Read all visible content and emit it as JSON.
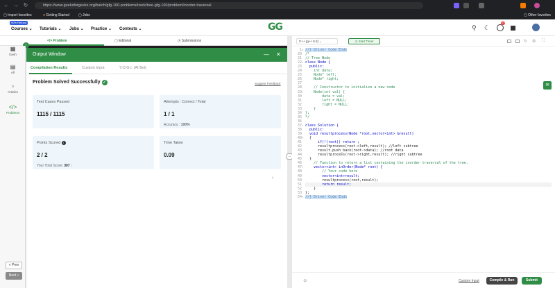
{
  "browser": {
    "url": "https://www.geeksforgeeks.org/batch/gfg-160-problems/track/tree-gfg-160/problem/inorder-traversal",
    "bookmarks": [
      "Import favorites",
      "Getting Started",
      "Jobs"
    ],
    "other_favorites": "Other favorites",
    "notif_count": "27"
  },
  "header": {
    "sale_badge": "90% Refund",
    "menu": [
      "Courses",
      "Tutorials",
      "Jobs",
      "Practice",
      "Contests"
    ],
    "logo_text": "GG"
  },
  "problem_tabs": [
    "Problem",
    "Editorial",
    "Submissions"
  ],
  "rail": {
    "items": [
      "Dash",
      "All",
      "Articles",
      "Problems"
    ],
    "prev": "Prev",
    "next": "Next"
  },
  "output": {
    "title": "Output Window",
    "tabs": [
      "Compilation Results",
      "Custom Input",
      "Y.O.G.I. (AI Bot)"
    ],
    "status": "Problem Solved Successfully",
    "suggest": "Suggest Feedback",
    "cards": {
      "test_label": "Test Cases Passed",
      "test_value": "1115 / 1115",
      "attempts_label": "Attempts : Correct / Total",
      "attempts_value": "1 / 1",
      "accuracy_label": "Accuracy :",
      "accuracy_value": "100%",
      "points_label": "Points Scored",
      "points_value": "2 / 2",
      "total_label": "Your Total Score:",
      "total_value": "307",
      "time_label": "Time Taken",
      "time_value": "0.09"
    }
  },
  "editor": {
    "language": "C++ (g++ 6.2)",
    "timer": "Start Timer",
    "lines": [
      {
        "n": "1",
        "t": "//} Driver Code Ends"
      },
      {
        "n": "20",
        "t": "/*"
      },
      {
        "n": "21",
        "t": "// Tree Node"
      },
      {
        "n": "22",
        "t": "class Node {"
      },
      {
        "n": "23",
        "t": "  public:"
      },
      {
        "n": "24",
        "t": "    int data;"
      },
      {
        "n": "25",
        "t": "    Node* left;"
      },
      {
        "n": "26",
        "t": "    Node* right;"
      },
      {
        "n": "27",
        "t": ""
      },
      {
        "n": "28",
        "t": "    // Constructor to initialize a new node"
      },
      {
        "n": "29",
        "t": "    Node(int val) {"
      },
      {
        "n": "30",
        "t": "        data = val;"
      },
      {
        "n": "31",
        "t": "        left = NULL;"
      },
      {
        "n": "32",
        "t": "        right = NULL;"
      },
      {
        "n": "33",
        "t": "    }"
      },
      {
        "n": "34",
        "t": "};"
      },
      {
        "n": "35",
        "t": "*/"
      },
      {
        "n": "36",
        "t": ""
      },
      {
        "n": "37",
        "t": "class Solution {"
      },
      {
        "n": "38",
        "t": "  public:"
      },
      {
        "n": "39",
        "t": "  void resultprocess(Node *root,vector<int> &result)"
      },
      {
        "n": "40",
        "t": "  {"
      },
      {
        "n": "41",
        "t": "      if(!(root)) return ;"
      },
      {
        "n": "42",
        "t": "      resultprocess(root->left,result); //left subtree"
      },
      {
        "n": "43",
        "t": "      result.push_back(root->data); //root data"
      },
      {
        "n": "44",
        "t": "      resultprocess(root->right,result); //right subtree"
      },
      {
        "n": "45",
        "t": "  }"
      },
      {
        "n": "46",
        "t": "    // Function to return a list containing the inorder traversal of the tree."
      },
      {
        "n": "47",
        "t": "    vector<int> inOrder(Node* root) {"
      },
      {
        "n": "48",
        "t": "        // Your code here"
      },
      {
        "n": "49",
        "t": "        vector<int>result;"
      },
      {
        "n": "50",
        "t": "        resultprocess(root,result);"
      },
      {
        "n": "51",
        "t": "        return result;"
      },
      {
        "n": "52",
        "t": "    }"
      },
      {
        "n": "53",
        "t": "};"
      },
      {
        "n": "54",
        "t": "//} Driver Code Ends"
      }
    ],
    "custom_input": "Custom Input",
    "compile_run": "Compile & Run",
    "submit": "Submit"
  },
  "colors": {
    "brand": "#2f8d46",
    "comment": "#2e8b57",
    "keyword": "#0000cc"
  }
}
